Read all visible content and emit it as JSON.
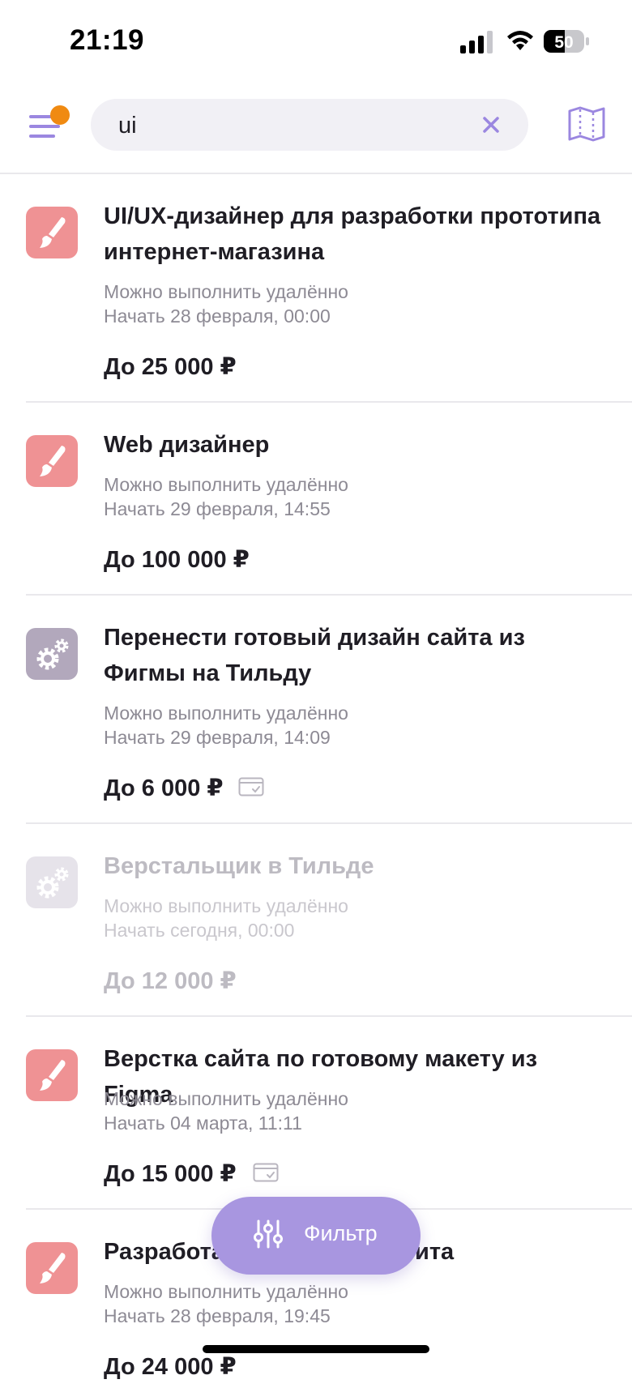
{
  "status_bar": {
    "time": "21:19",
    "battery": "50"
  },
  "search": {
    "value": "ui"
  },
  "filter": {
    "label": "Фильтр"
  },
  "colors": {
    "accent": "#9b87e0",
    "notification": "#f08a12",
    "design_icon": "#ef9294",
    "dev_icon": "#b2a8bc"
  },
  "jobs": [
    {
      "title": "UI/UX-дизайнер для разработки прототипа интернет-магазина",
      "remote": "Можно выполнить удалённо",
      "start": "Начать 28 февраля, 00:00",
      "price": "До 25 000 ₽",
      "icon": "paintbrush-icon",
      "payment_card": false
    },
    {
      "title": "Web дизайнер",
      "remote": "Можно выполнить удалённо",
      "start": "Начать 29 февраля, 14:55",
      "price": "До 100 000 ₽",
      "icon": "paintbrush-icon",
      "payment_card": false
    },
    {
      "title": "Перенести готовый дизайн сайта из Фигмы на Тильду",
      "remote": "Можно выполнить удалённо",
      "start": "Начать 29 февраля, 14:09",
      "price": "До 6 000 ₽",
      "icon": "gears-icon",
      "payment_card": true
    },
    {
      "title": "Верстальщик в Тильде",
      "remote": "Можно выполнить удалённо",
      "start": "Начать сегодня, 00:00",
      "price": "До 12 000 ₽",
      "icon": "gears-icon",
      "payment_card": false
    },
    {
      "title": "Верстка сайта по готовому макету из Figma",
      "remote": "Можно выполнить удалённо",
      "start": "Начать 04 марта, 11:11",
      "price": "До 15 000 ₽",
      "icon": "paintbrush-icon",
      "payment_card": true
    },
    {
      "title": "Разработа",
      "title_end": "ита",
      "remote": "Можно выполнить удалённо",
      "start": "Начать 28 февраля, 19:45",
      "price": "До 24 000 ₽",
      "icon": "paintbrush-icon",
      "payment_card": false
    }
  ]
}
